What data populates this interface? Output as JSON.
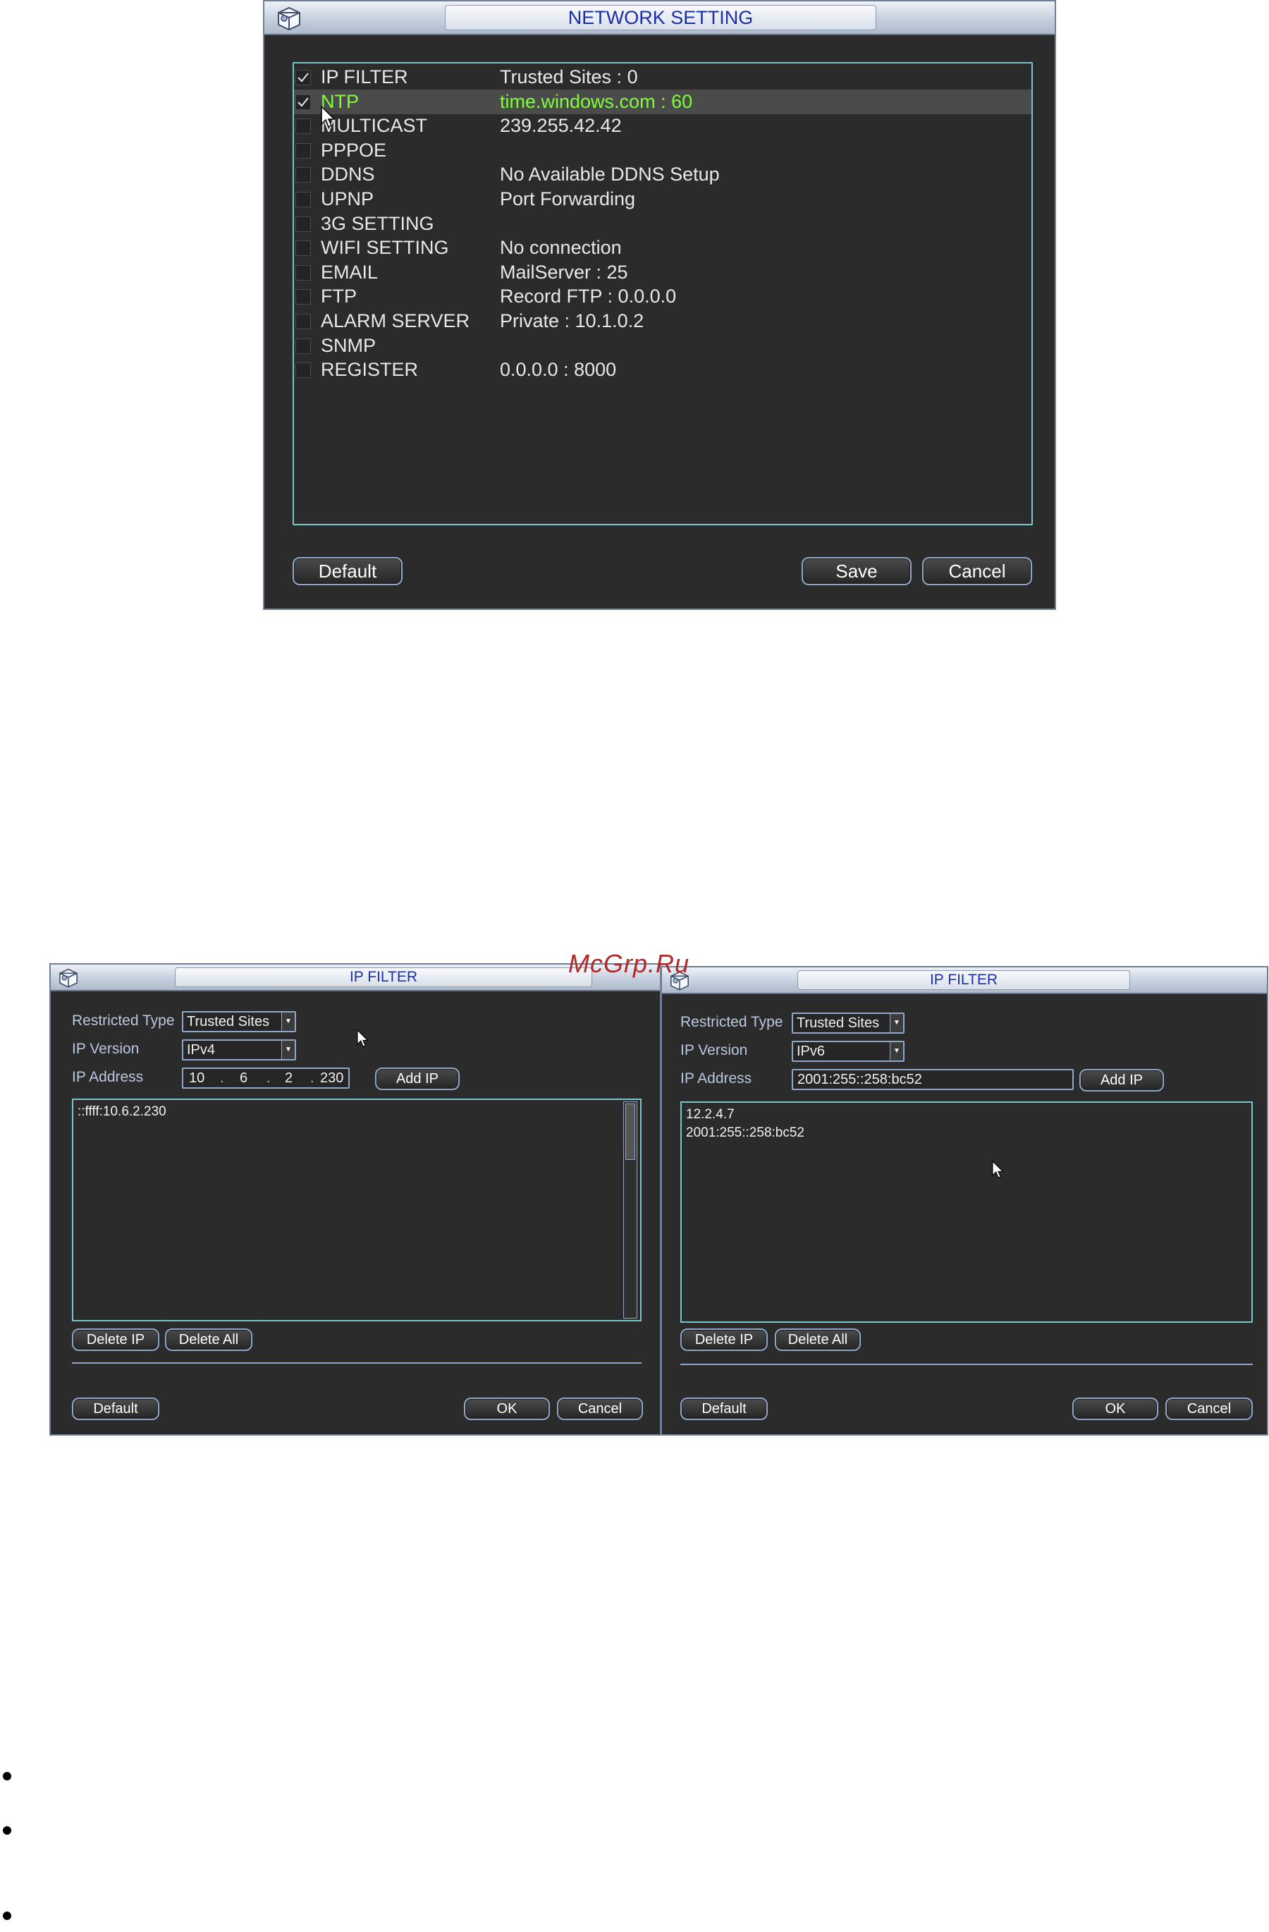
{
  "network_setting": {
    "title": "NETWORK SETTING",
    "items": [
      {
        "name": "IP FILTER",
        "value": "Trusted Sites : 0",
        "checked": true,
        "selected": false
      },
      {
        "name": "NTP",
        "value": "time.windows.com : 60",
        "checked": true,
        "selected": true
      },
      {
        "name": "MULTICAST",
        "value": "239.255.42.42",
        "checked": false,
        "selected": false
      },
      {
        "name": "PPPOE",
        "value": "",
        "checked": false,
        "selected": false
      },
      {
        "name": "DDNS",
        "value": "No Available DDNS Setup",
        "checked": false,
        "selected": false
      },
      {
        "name": "UPNP",
        "value": "Port Forwarding",
        "checked": false,
        "selected": false
      },
      {
        "name": "3G SETTING",
        "value": "",
        "checked": false,
        "selected": false
      },
      {
        "name": "WIFI SETTING",
        "value": "No connection",
        "checked": false,
        "selected": false
      },
      {
        "name": "EMAIL",
        "value": "MailServer : 25",
        "checked": false,
        "selected": false
      },
      {
        "name": "FTP",
        "value": "Record FTP : 0.0.0.0",
        "checked": false,
        "selected": false
      },
      {
        "name": "ALARM SERVER",
        "value": "Private : 10.1.0.2",
        "checked": false,
        "selected": false
      },
      {
        "name": "SNMP",
        "value": "",
        "checked": false,
        "selected": false
      },
      {
        "name": "REGISTER",
        "value": "0.0.0.0 : 8000",
        "checked": false,
        "selected": false
      }
    ],
    "buttons": {
      "default": "Default",
      "save": "Save",
      "cancel": "Cancel"
    }
  },
  "ip_filter_ipv4": {
    "title": "IP FILTER",
    "restricted_type_label": "Restricted Type",
    "restricted_type_value": "Trusted Sites",
    "ip_version_label": "IP Version",
    "ip_version_value": "IPv4",
    "ip_address_label": "IP Address",
    "ip_octets": [
      "10",
      "6",
      "2",
      "230"
    ],
    "ip_separator": ".",
    "add_ip": "Add IP",
    "list": [
      "::ffff:10.6.2.230"
    ],
    "delete_ip": "Delete IP",
    "delete_all": "Delete All",
    "default": "Default",
    "ok": "OK",
    "cancel": "Cancel"
  },
  "ip_filter_ipv6": {
    "title": "IP FILTER",
    "restricted_type_label": "Restricted Type",
    "restricted_type_value": "Trusted Sites",
    "ip_version_label": "IP Version",
    "ip_version_value": "IPv6",
    "ip_address_label": "IP Address",
    "ip_address_value": "2001:255::258:bc52",
    "add_ip": "Add IP",
    "list": [
      "12.2.4.7",
      "2001:255::258:bc52"
    ],
    "delete_ip": "Delete IP",
    "delete_all": "Delete All",
    "default": "Default",
    "ok": "OK",
    "cancel": "Cancel"
  },
  "watermark": "McGrp.Ru",
  "colors": {
    "window_bg": "#2b2b2b",
    "title_text": "#1b2fa6",
    "frame_border": "#78c8c8",
    "selected_text": "#7fff3a",
    "label_text": "#b9c8e0",
    "watermark": "#b02a2a"
  },
  "icons": [
    "app-icon",
    "checkmark-icon",
    "dropdown-arrow-icon",
    "mouse-pointer-icon",
    "bullet-icon"
  ]
}
